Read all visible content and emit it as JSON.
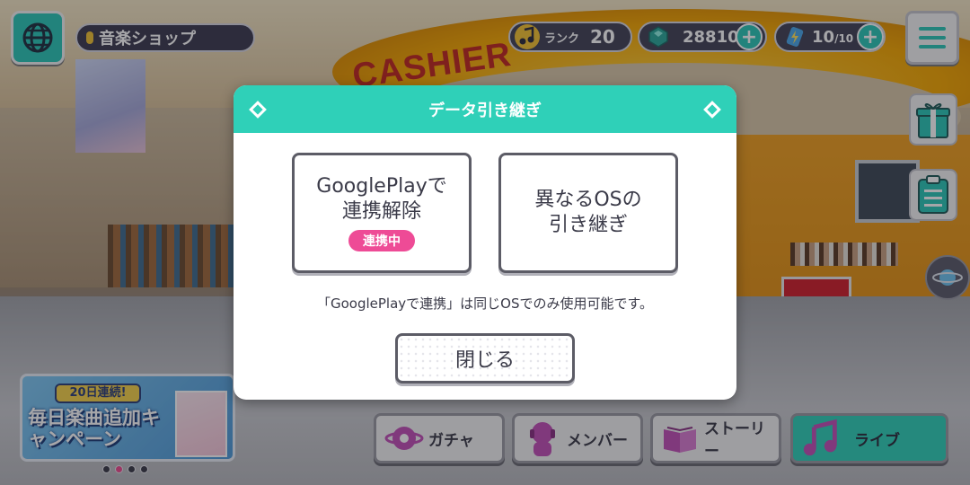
{
  "header": {
    "location": "音楽ショップ",
    "rank_label": "ランク",
    "rank_value": "20",
    "gems": "28810",
    "energy": "10",
    "energy_max": "/10"
  },
  "scene": {
    "sign_text": "CASHIER"
  },
  "banner": {
    "tag": "20日連続!",
    "title": "毎日楽曲追加キャンペーン"
  },
  "nav": {
    "gacha": "ガチャ",
    "members": "メンバー",
    "story": "ストーリー",
    "live": "ライブ"
  },
  "modal": {
    "title": "データ引き継ぎ",
    "option_google": "GooglePlayで\n連携解除",
    "option_google_badge": "連携中",
    "option_os": "異なるOSの\n引き継ぎ",
    "note": "「GooglePlayで連携」は同じOSでのみ使用可能です。",
    "close": "閉じる"
  },
  "colors": {
    "accent": "#2fd0b8",
    "badge": "#ee4b96"
  },
  "icons": [
    "globe-icon",
    "map-pin-icon",
    "music-note-icon",
    "gem-icon",
    "energy-icon",
    "plus-icon",
    "hamburger-menu-icon",
    "gift-icon",
    "clipboard-icon",
    "planet-icon",
    "gacha-icon",
    "member-icon",
    "book-icon",
    "live-icon"
  ]
}
